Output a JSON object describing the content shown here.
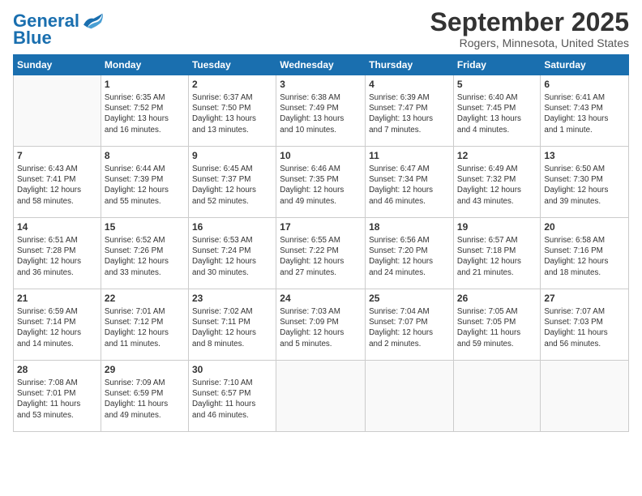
{
  "header": {
    "logo_line1": "General",
    "logo_line2": "Blue",
    "month": "September 2025",
    "location": "Rogers, Minnesota, United States"
  },
  "weekdays": [
    "Sunday",
    "Monday",
    "Tuesday",
    "Wednesday",
    "Thursday",
    "Friday",
    "Saturday"
  ],
  "weeks": [
    [
      {
        "day": "",
        "info": ""
      },
      {
        "day": "1",
        "info": "Sunrise: 6:35 AM\nSunset: 7:52 PM\nDaylight: 13 hours\nand 16 minutes."
      },
      {
        "day": "2",
        "info": "Sunrise: 6:37 AM\nSunset: 7:50 PM\nDaylight: 13 hours\nand 13 minutes."
      },
      {
        "day": "3",
        "info": "Sunrise: 6:38 AM\nSunset: 7:49 PM\nDaylight: 13 hours\nand 10 minutes."
      },
      {
        "day": "4",
        "info": "Sunrise: 6:39 AM\nSunset: 7:47 PM\nDaylight: 13 hours\nand 7 minutes."
      },
      {
        "day": "5",
        "info": "Sunrise: 6:40 AM\nSunset: 7:45 PM\nDaylight: 13 hours\nand 4 minutes."
      },
      {
        "day": "6",
        "info": "Sunrise: 6:41 AM\nSunset: 7:43 PM\nDaylight: 13 hours\nand 1 minute."
      }
    ],
    [
      {
        "day": "7",
        "info": "Sunrise: 6:43 AM\nSunset: 7:41 PM\nDaylight: 12 hours\nand 58 minutes."
      },
      {
        "day": "8",
        "info": "Sunrise: 6:44 AM\nSunset: 7:39 PM\nDaylight: 12 hours\nand 55 minutes."
      },
      {
        "day": "9",
        "info": "Sunrise: 6:45 AM\nSunset: 7:37 PM\nDaylight: 12 hours\nand 52 minutes."
      },
      {
        "day": "10",
        "info": "Sunrise: 6:46 AM\nSunset: 7:35 PM\nDaylight: 12 hours\nand 49 minutes."
      },
      {
        "day": "11",
        "info": "Sunrise: 6:47 AM\nSunset: 7:34 PM\nDaylight: 12 hours\nand 46 minutes."
      },
      {
        "day": "12",
        "info": "Sunrise: 6:49 AM\nSunset: 7:32 PM\nDaylight: 12 hours\nand 43 minutes."
      },
      {
        "day": "13",
        "info": "Sunrise: 6:50 AM\nSunset: 7:30 PM\nDaylight: 12 hours\nand 39 minutes."
      }
    ],
    [
      {
        "day": "14",
        "info": "Sunrise: 6:51 AM\nSunset: 7:28 PM\nDaylight: 12 hours\nand 36 minutes."
      },
      {
        "day": "15",
        "info": "Sunrise: 6:52 AM\nSunset: 7:26 PM\nDaylight: 12 hours\nand 33 minutes."
      },
      {
        "day": "16",
        "info": "Sunrise: 6:53 AM\nSunset: 7:24 PM\nDaylight: 12 hours\nand 30 minutes."
      },
      {
        "day": "17",
        "info": "Sunrise: 6:55 AM\nSunset: 7:22 PM\nDaylight: 12 hours\nand 27 minutes."
      },
      {
        "day": "18",
        "info": "Sunrise: 6:56 AM\nSunset: 7:20 PM\nDaylight: 12 hours\nand 24 minutes."
      },
      {
        "day": "19",
        "info": "Sunrise: 6:57 AM\nSunset: 7:18 PM\nDaylight: 12 hours\nand 21 minutes."
      },
      {
        "day": "20",
        "info": "Sunrise: 6:58 AM\nSunset: 7:16 PM\nDaylight: 12 hours\nand 18 minutes."
      }
    ],
    [
      {
        "day": "21",
        "info": "Sunrise: 6:59 AM\nSunset: 7:14 PM\nDaylight: 12 hours\nand 14 minutes."
      },
      {
        "day": "22",
        "info": "Sunrise: 7:01 AM\nSunset: 7:12 PM\nDaylight: 12 hours\nand 11 minutes."
      },
      {
        "day": "23",
        "info": "Sunrise: 7:02 AM\nSunset: 7:11 PM\nDaylight: 12 hours\nand 8 minutes."
      },
      {
        "day": "24",
        "info": "Sunrise: 7:03 AM\nSunset: 7:09 PM\nDaylight: 12 hours\nand 5 minutes."
      },
      {
        "day": "25",
        "info": "Sunrise: 7:04 AM\nSunset: 7:07 PM\nDaylight: 12 hours\nand 2 minutes."
      },
      {
        "day": "26",
        "info": "Sunrise: 7:05 AM\nSunset: 7:05 PM\nDaylight: 11 hours\nand 59 minutes."
      },
      {
        "day": "27",
        "info": "Sunrise: 7:07 AM\nSunset: 7:03 PM\nDaylight: 11 hours\nand 56 minutes."
      }
    ],
    [
      {
        "day": "28",
        "info": "Sunrise: 7:08 AM\nSunset: 7:01 PM\nDaylight: 11 hours\nand 53 minutes."
      },
      {
        "day": "29",
        "info": "Sunrise: 7:09 AM\nSunset: 6:59 PM\nDaylight: 11 hours\nand 49 minutes."
      },
      {
        "day": "30",
        "info": "Sunrise: 7:10 AM\nSunset: 6:57 PM\nDaylight: 11 hours\nand 46 minutes."
      },
      {
        "day": "",
        "info": ""
      },
      {
        "day": "",
        "info": ""
      },
      {
        "day": "",
        "info": ""
      },
      {
        "day": "",
        "info": ""
      }
    ]
  ]
}
